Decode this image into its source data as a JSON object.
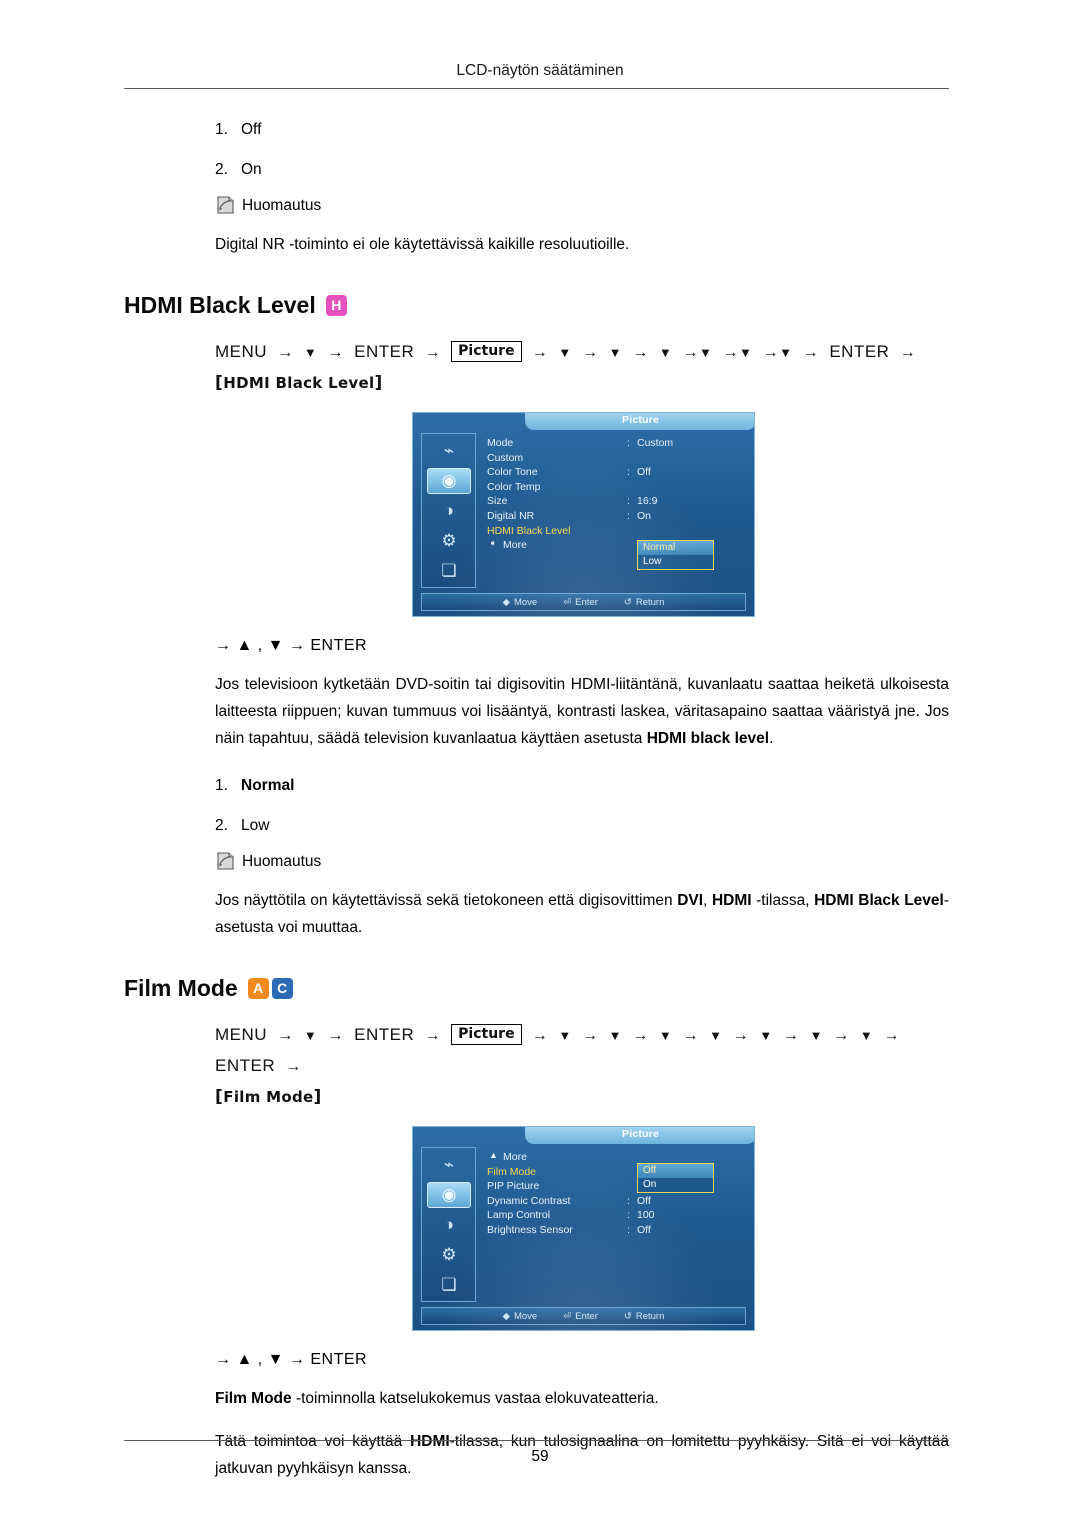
{
  "header": {
    "title": "LCD-näytön säätäminen"
  },
  "footer": {
    "page_number": "59"
  },
  "digital_nr": {
    "options": [
      {
        "num": "1.",
        "label": "Off"
      },
      {
        "num": "2.",
        "label": "On"
      }
    ],
    "note_label": "Huomautus",
    "note_text": "Digital NR -toiminto ei ole käytettävissä kaikille resoluutioille."
  },
  "hdmi_black_level": {
    "heading": "HDMI Black Level",
    "tags": [
      {
        "letter": "H",
        "color": "#e552bf"
      }
    ],
    "path": {
      "menu": "MENU",
      "enter": "ENTER",
      "picture": "Picture",
      "target": "HDMI Black Level",
      "tail": "ENTER"
    },
    "enter_line": "ENTER",
    "body": "Jos televisioon kytketään DVD-soitin tai digisovitin HDMI-liitäntänä, kuvanlaatu saattaa heiketä ulkoisesta laitteesta riippuen; kuvan tummuus voi lisääntyä, kontrasti laskea, väritasapaino saattaa vääristyä jne. Jos näin tapahtuu, säädä television kuvanlaatua käyttäen asetusta ",
    "body_bold": "HDMI black level",
    "body_end": ".",
    "options": [
      {
        "num": "1.",
        "label": "Normal"
      },
      {
        "num": "2.",
        "label": "Low"
      }
    ],
    "note_label": "Huomautus",
    "note_text_1": "Jos näyttötila on käytettävissä sekä tietokoneen että digisovittimen ",
    "note_bold_1": "DVI",
    "note_text_2": ", ",
    "note_bold_2": "HDMI",
    "note_text_3": " -tilassa, ",
    "note_bold_3": "HDMI Black Level",
    "note_text_4": "-asetusta voi muuttaa.",
    "osd": {
      "title": "Picture",
      "rows": [
        {
          "label": "Mode",
          "colon": ":",
          "value": "Custom",
          "highlight": false
        },
        {
          "label": "Custom",
          "colon": "",
          "value": "",
          "highlight": false
        },
        {
          "label": "Color Tone",
          "colon": ":",
          "value": "Off",
          "highlight": false
        },
        {
          "label": "Color Temp",
          "colon": "",
          "value": "",
          "highlight": false
        },
        {
          "label": "Size",
          "colon": ":",
          "value": "16:9",
          "highlight": false
        },
        {
          "label": "Digital NR",
          "colon": ":",
          "value": "On",
          "highlight": false
        },
        {
          "label": "HDMI Black Level",
          "colon": "",
          "value": "",
          "highlight": true
        }
      ],
      "more_label": "More",
      "popup": [
        {
          "label": "Normal",
          "selected": true
        },
        {
          "label": "Low",
          "selected": false
        }
      ],
      "footer": [
        {
          "key": "◆",
          "label": "Move"
        },
        {
          "key": "⏎",
          "label": "Enter"
        },
        {
          "key": "↺",
          "label": "Return"
        }
      ],
      "sidebar_icons": [
        "input-icon",
        "picture-icon",
        "sound-icon",
        "setup-icon",
        "multi-control-icon"
      ],
      "selected_sidebar_index": 1
    }
  },
  "film_mode": {
    "heading": "Film Mode",
    "tags": [
      {
        "letter": "A",
        "color": "#f08a1e"
      },
      {
        "letter": "C",
        "color": "#2b6bb5"
      }
    ],
    "path": {
      "menu": "MENU",
      "enter": "ENTER",
      "picture": "Picture",
      "target": "Film Mode",
      "tail": "ENTER"
    },
    "enter_line": "ENTER",
    "body_1_bold": "Film Mode",
    "body_1": " -toiminnolla katselukokemus vastaa elokuvateatteria.",
    "body_2_a": "Tätä toimintoa voi käyttää ",
    "body_2_bold": "HDMI",
    "body_2_b": "-tilassa, kun tulosignaalina on lomitettu pyyhkäisy. Sitä ei voi käyttää jatkuvan pyyhkäisyn kanssa.",
    "osd": {
      "title": "Picture",
      "more_label": "More",
      "rows": [
        {
          "label": "Film Mode",
          "colon": "",
          "value": "",
          "highlight": true
        },
        {
          "label": "PIP Picture",
          "colon": "",
          "value": "",
          "highlight": false
        },
        {
          "label": "Dynamic Contrast",
          "colon": ":",
          "value": "Off",
          "highlight": false
        },
        {
          "label": "Lamp Control",
          "colon": ":",
          "value": "100",
          "highlight": false
        },
        {
          "label": "Brightness Sensor",
          "colon": ":",
          "value": "Off",
          "highlight": false
        }
      ],
      "popup": [
        {
          "label": "Off",
          "selected": true
        },
        {
          "label": "On",
          "selected": false
        }
      ],
      "footer": [
        {
          "key": "◆",
          "label": "Move"
        },
        {
          "key": "⏎",
          "label": "Enter"
        },
        {
          "key": "↺",
          "label": "Return"
        }
      ],
      "sidebar_icons": [
        "input-icon",
        "picture-icon",
        "sound-icon",
        "setup-icon",
        "multi-control-icon"
      ],
      "selected_sidebar_index": 1
    }
  }
}
